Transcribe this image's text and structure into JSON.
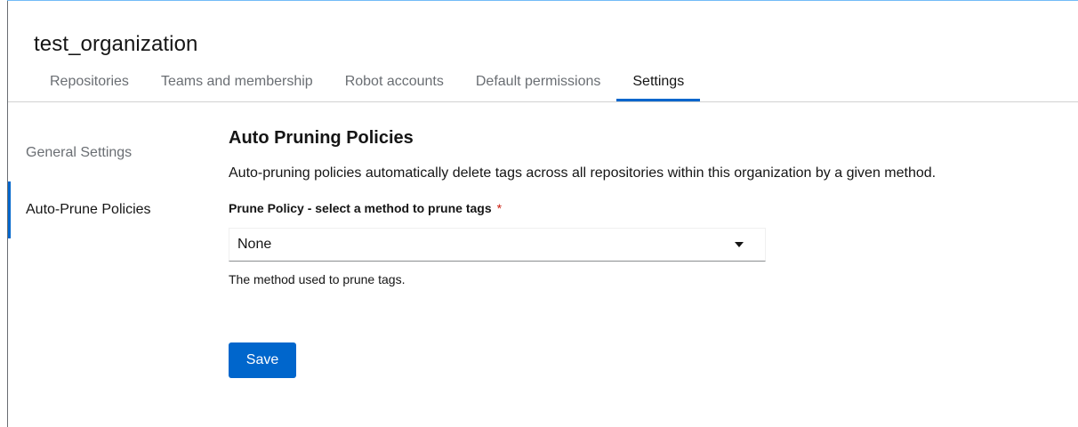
{
  "org": {
    "name": "test_organization"
  },
  "tabs": [
    {
      "label": "Repositories",
      "active": false
    },
    {
      "label": "Teams and membership",
      "active": false
    },
    {
      "label": "Robot accounts",
      "active": false
    },
    {
      "label": "Default permissions",
      "active": false
    },
    {
      "label": "Settings",
      "active": true
    }
  ],
  "side_nav": [
    {
      "label": "General Settings",
      "active": false
    },
    {
      "label": "Auto-Prune Policies",
      "active": true
    }
  ],
  "content": {
    "title": "Auto Pruning Policies",
    "description": "Auto-pruning policies automatically delete tags across all repositories within this organization by a given method.",
    "field_label": "Prune Policy - select a method to prune tags",
    "required_mark": "*",
    "select_value": "None",
    "helper_text": "The method used to prune tags.",
    "save_label": "Save"
  },
  "colors": {
    "accent": "#0066cc",
    "required": "#c9190b"
  }
}
